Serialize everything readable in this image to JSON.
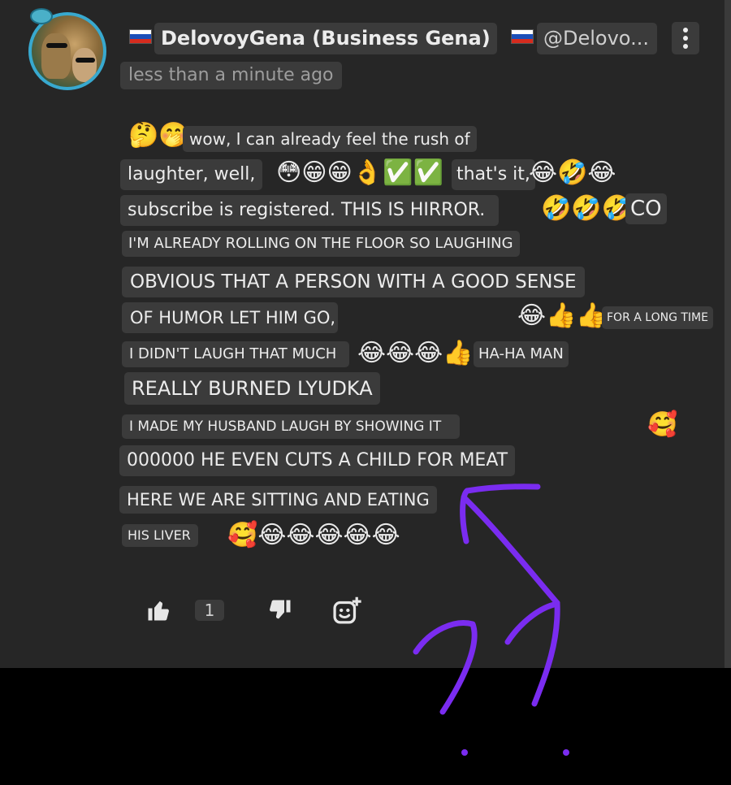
{
  "comment": {
    "author": "DelovoyGena (Business Gena)",
    "handle": "@Delovo...",
    "timestamp": "less than a minute ago",
    "lines": [
      {
        "prefix_emoji": "🤔🤭",
        "text": "wow, I can already feel the rush of"
      },
      {
        "text": "laughter, well,",
        "mid_emoji": "😳😁😁👌✅✅",
        "text2": "that's it,",
        "suffix_emoji": "😂🤣😂"
      },
      {
        "text": "subscribe is registered. THIS IS HIRROR.",
        "mid_emoji": "🤣🤣🤣",
        "text2": "CO"
      },
      {
        "text": "I'M ALREADY ROLLING ON THE FLOOR SO LAUGHING"
      },
      {
        "text": "OBVIOUS THAT A PERSON WITH A GOOD SENSE"
      },
      {
        "text": "OF HUMOR LET HIM GO,",
        "mid_emoji": "😂👍👍",
        "text2": "FOR A LONG TIME"
      },
      {
        "text": "I DIDN'T LAUGH THAT MUCH",
        "mid_emoji": "😂😂😂👍",
        "text2": "HA-HA MAN"
      },
      {
        "text": "REALLY BURNED LYUDKA"
      },
      {
        "text": "I MADE MY HUSBAND LAUGH BY SHOWING IT",
        "suffix_emoji": "🥰"
      },
      {
        "text": "000000 HE EVEN CUTS A CHILD FOR MEAT"
      },
      {
        "text": "HERE WE ARE SITTING AND EATING"
      },
      {
        "text": "HIS LIVER",
        "suffix_emoji": "🥰😂😂😂😂😂"
      }
    ],
    "like_count": "1"
  },
  "icons": {
    "like": "thumbs-up-icon",
    "dislike": "thumbs-down-icon",
    "reply": "add-reaction-icon",
    "menu": "more-vert-icon",
    "flag": "russia-flag-icon"
  },
  "colors": {
    "panel": "#262626",
    "pill": "#3b3b3b",
    "avatar_ring": "#38a9cf",
    "scribble": "#7a2cf0"
  }
}
